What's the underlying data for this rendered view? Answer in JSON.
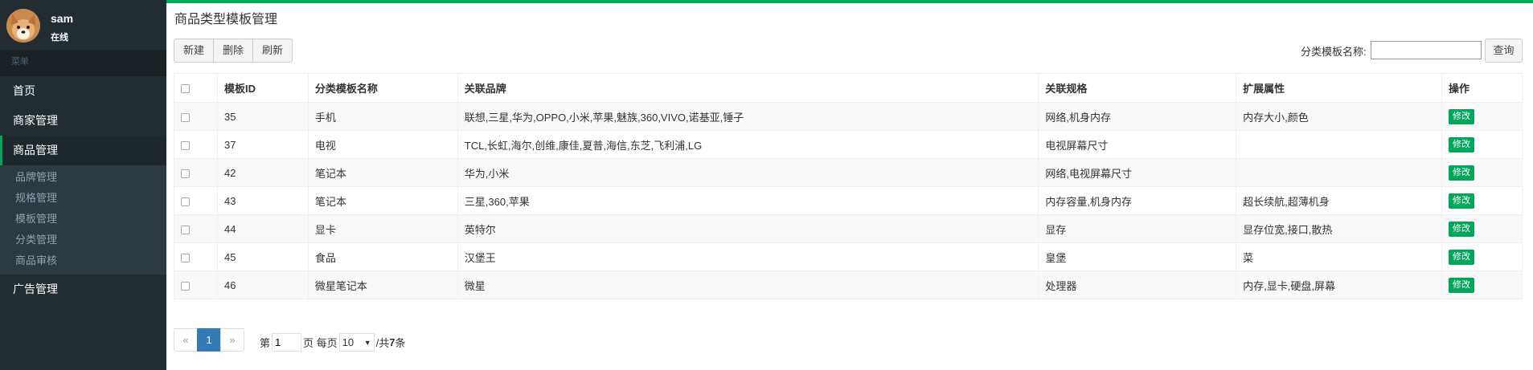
{
  "user": {
    "name": "sam",
    "status": "在线"
  },
  "sidebar": {
    "header": "菜单",
    "items": [
      {
        "label": "首页"
      },
      {
        "label": "商家管理"
      },
      {
        "label": "商品管理"
      },
      {
        "label": "广告管理"
      }
    ],
    "subitems": [
      {
        "label": "品牌管理"
      },
      {
        "label": "规格管理"
      },
      {
        "label": "模板管理"
      },
      {
        "label": "分类管理"
      },
      {
        "label": "商品审核"
      }
    ]
  },
  "page": {
    "title": "商品类型模板管理"
  },
  "toolbar": {
    "new_label": "新建",
    "delete_label": "删除",
    "refresh_label": "刷新"
  },
  "search": {
    "label": "分类模板名称:",
    "value": "",
    "button": "查询"
  },
  "table": {
    "headers": [
      "模板ID",
      "分类模板名称",
      "关联品牌",
      "关联规格",
      "扩展属性",
      "操作"
    ],
    "edit_label": "修改",
    "rows": [
      {
        "id": "35",
        "name": "手机",
        "brands": "联想,三星,华为,OPPO,小米,苹果,魅族,360,VIVO,诺基亚,锤子",
        "specs": "网络,机身内存",
        "attrs": "内存大小,颜色"
      },
      {
        "id": "37",
        "name": "电视",
        "brands": "TCL,长虹,海尔,创维,康佳,夏普,海信,东芝,飞利浦,LG",
        "specs": "电视屏幕尺寸",
        "attrs": ""
      },
      {
        "id": "42",
        "name": "笔记本",
        "brands": "华为,小米",
        "specs": "网络,电视屏幕尺寸",
        "attrs": ""
      },
      {
        "id": "43",
        "name": "笔记本",
        "brands": "三星,360,苹果",
        "specs": "内存容量,机身内存",
        "attrs": "超长续航,超薄机身"
      },
      {
        "id": "44",
        "name": "显卡",
        "brands": "英特尔",
        "specs": "显存",
        "attrs": "显存位宽,接口,散热"
      },
      {
        "id": "45",
        "name": "食品",
        "brands": "汉堡王",
        "specs": "皇堡",
        "attrs": "菜"
      },
      {
        "id": "46",
        "name": "微星笔记本",
        "brands": "微星",
        "specs": "处理器",
        "attrs": "内存,显卡,硬盘,屏幕"
      }
    ]
  },
  "pagination": {
    "prev": "«",
    "current": "1",
    "next": "»",
    "page_prefix": "第",
    "page_value": "1",
    "page_suffix": "页 每页",
    "page_size": "10",
    "total_prefix": "/共",
    "total": "7",
    "total_suffix": "条"
  },
  "colors": {
    "sidebar_bg": "#222d32",
    "accent": "#00a65a",
    "primary": "#337ab7"
  }
}
